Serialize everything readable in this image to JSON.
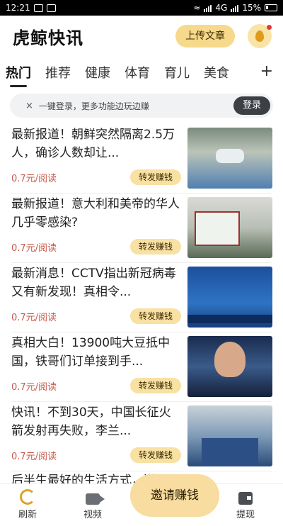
{
  "status_bar": {
    "time": "12:21",
    "network": "4G",
    "battery": "15%"
  },
  "header": {
    "title": "虎鲸快讯",
    "upload_label": "上传文章"
  },
  "tabs": [
    {
      "label": "热门"
    },
    {
      "label": "推荐"
    },
    {
      "label": "健康"
    },
    {
      "label": "体育"
    },
    {
      "label": "育儿"
    },
    {
      "label": "美食"
    }
  ],
  "tab_add": "+",
  "login_bar": {
    "close": "×",
    "text": "一键登录，更多功能边玩边赚",
    "button": "登录"
  },
  "feed": [
    {
      "title": "最新报道！朝鲜突然隔离2.5万人，确诊人数却让...",
      "price": "0.7元/阅读",
      "share": "转发赚钱"
    },
    {
      "title": "最新报道！意大利和美帝的华人几乎零感染?",
      "price": "0.7元/阅读",
      "share": "转发赚钱"
    },
    {
      "title": "最新消息！CCTV指出新冠病毒又有新发现！真相令...",
      "price": "0.7元/阅读",
      "share": "转发赚钱"
    },
    {
      "title": "真相大白！13900吨大豆抵中国，铁哥们订单接到手...",
      "price": "0.7元/阅读",
      "share": "转发赚钱"
    },
    {
      "title": "快讯！不到30天，中国长征火箭发射再失败，李兰...",
      "price": "0.7元/阅读",
      "share": "转发赚钱"
    }
  ],
  "partial_item_title": "后半生最好的生活方式，送...",
  "bottom_nav": {
    "refresh": "刷新",
    "video": "视频",
    "invite": "邀请赚钱",
    "withdraw": "提现"
  }
}
